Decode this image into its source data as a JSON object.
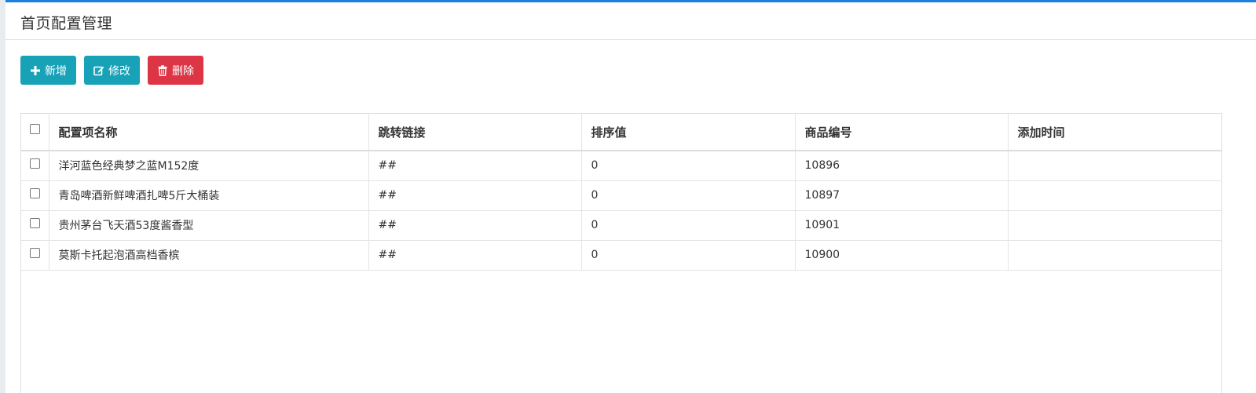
{
  "page": {
    "title": "首页配置管理"
  },
  "toolbar": {
    "add_label": "新增",
    "edit_label": "修改",
    "delete_label": "删除"
  },
  "colors": {
    "accent": "#1a7fe0",
    "info_button": "#17a2b8",
    "danger_button": "#dc3545"
  },
  "table": {
    "columns": [
      "配置项名称",
      "跳转链接",
      "排序值",
      "商品编号",
      "添加时间"
    ],
    "rows": [
      {
        "name": "洋河蓝色经典梦之蓝M152度",
        "link": "##",
        "sort": "0",
        "goods_no": "10896",
        "added": ""
      },
      {
        "name": "青岛啤酒新鲜啤酒扎啤5斤大桶装",
        "link": "##",
        "sort": "0",
        "goods_no": "10897",
        "added": ""
      },
      {
        "name": "贵州茅台飞天酒53度酱香型",
        "link": "##",
        "sort": "0",
        "goods_no": "10901",
        "added": ""
      },
      {
        "name": "莫斯卡托起泡酒高档香槟",
        "link": "##",
        "sort": "0",
        "goods_no": "10900",
        "added": ""
      }
    ]
  }
}
